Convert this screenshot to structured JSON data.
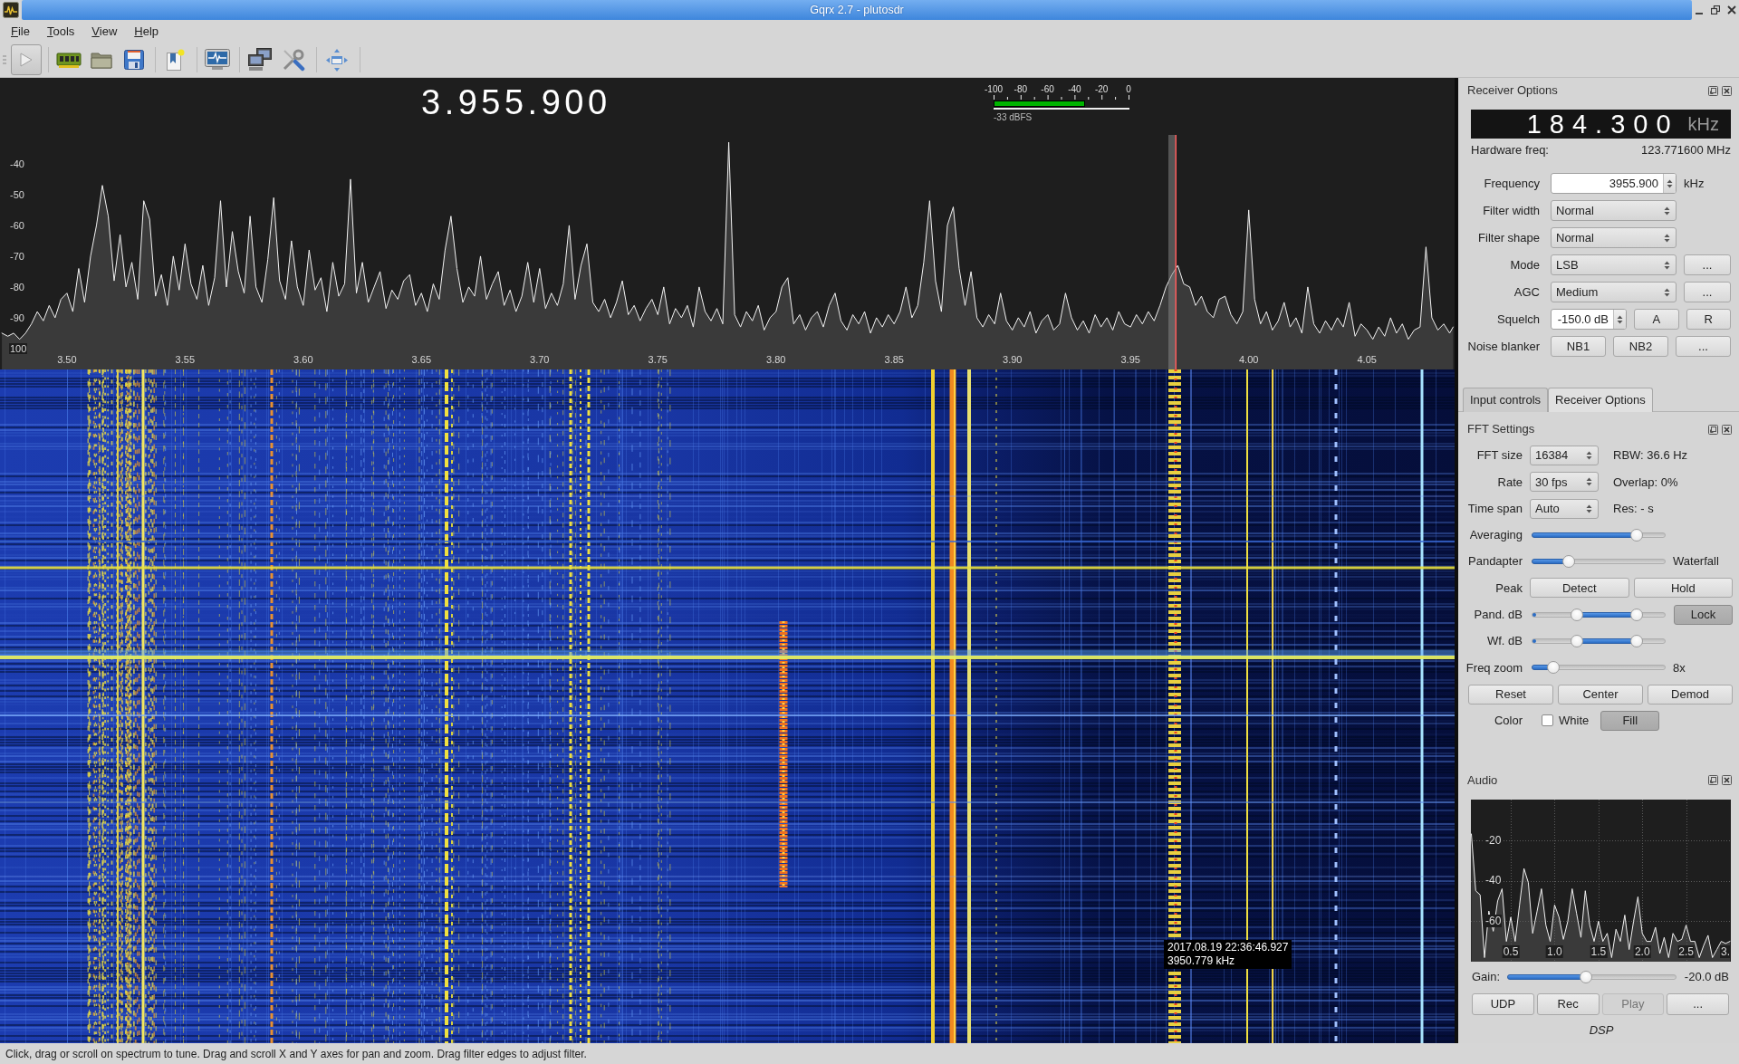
{
  "window": {
    "title": "Gqrx 2.7 - plutosdr"
  },
  "menu": [
    "File",
    "Tools",
    "View",
    "Help"
  ],
  "spectrum": {
    "frequency": "3.955.900",
    "meter": {
      "scale": [
        "-100",
        "-80",
        "-60",
        "-40",
        "-20",
        "0"
      ],
      "level": 0.67,
      "reading": "-33 dBFS"
    },
    "chart_data": {
      "type": "line",
      "xlim": [
        3.4717,
        4.0871
      ],
      "ylim": [
        -106.8,
        -12.1
      ],
      "xticks": [
        {
          "value": 3.5,
          "label": "3.50"
        },
        3.55,
        {
          "value": 3.6,
          "label": "3.60"
        },
        3.65,
        {
          "value": 3.7,
          "label": "3.70"
        },
        3.75,
        {
          "value": 3.8,
          "label": "3.80"
        },
        3.85,
        {
          "value": 3.9,
          "label": "3.90"
        },
        3.95,
        {
          "value": 4,
          "label": "4.00"
        },
        4.05
      ],
      "yticks": [
        -40,
        -50,
        -60,
        -70,
        -80,
        -90,
        {
          "value": -100,
          "label": "100"
        }
      ],
      "x": [
        3.4725,
        3.475,
        3.4775,
        3.48,
        3.4825,
        3.485,
        3.4875,
        3.49,
        3.4925,
        3.495,
        3.4975,
        3.5,
        3.5025,
        3.505,
        3.5075,
        3.51,
        3.5125,
        3.515,
        3.5175,
        3.52,
        3.5225,
        3.525,
        3.5275,
        3.53,
        3.5325,
        3.535,
        3.5375,
        3.54,
        3.5425,
        3.545,
        3.5475,
        3.55,
        3.5525,
        3.555,
        3.5575,
        3.56,
        3.5625,
        3.565,
        3.5675,
        3.57,
        3.5725,
        3.575,
        3.5775,
        3.58,
        3.5825,
        3.585,
        3.5875,
        3.59,
        3.5925,
        3.595,
        3.5975,
        3.6,
        3.6025,
        3.605,
        3.6075,
        3.61,
        3.6125,
        3.615,
        3.6175,
        3.62,
        3.6225,
        3.625,
        3.6275,
        3.63,
        3.6325,
        3.635,
        3.6375,
        3.64,
        3.6425,
        3.645,
        3.6475,
        3.65,
        3.6525,
        3.655,
        3.6575,
        3.66,
        3.6625,
        3.665,
        3.6675,
        3.67,
        3.6725,
        3.675,
        3.6775,
        3.68,
        3.6825,
        3.685,
        3.6875,
        3.69,
        3.6925,
        3.695,
        3.6975,
        3.7,
        3.7025,
        3.705,
        3.7075,
        3.71,
        3.7125,
        3.715,
        3.7175,
        3.72,
        3.7225,
        3.725,
        3.7275,
        3.73,
        3.7325,
        3.735,
        3.7375,
        3.74,
        3.7425,
        3.745,
        3.7475,
        3.75,
        3.7525,
        3.755,
        3.7575,
        3.76,
        3.7625,
        3.765,
        3.7675,
        3.77,
        3.7725,
        3.775,
        3.7775,
        3.78,
        3.7825,
        3.785,
        3.7875,
        3.79,
        3.7925,
        3.795,
        3.7975,
        3.8,
        3.8025,
        3.805,
        3.8075,
        3.81,
        3.8125,
        3.815,
        3.8175,
        3.82,
        3.8225,
        3.825,
        3.8275,
        3.83,
        3.8325,
        3.835,
        3.8375,
        3.84,
        3.8425,
        3.845,
        3.8475,
        3.85,
        3.8525,
        3.855,
        3.8575,
        3.86,
        3.8625,
        3.865,
        3.8675,
        3.87,
        3.8725,
        3.875,
        3.8775,
        3.88,
        3.8825,
        3.885,
        3.8875,
        3.89,
        3.8925,
        3.895,
        3.8975,
        3.9,
        3.9025,
        3.905,
        3.9075,
        3.91,
        3.9125,
        3.915,
        3.9175,
        3.92,
        3.9225,
        3.925,
        3.9275,
        3.93,
        3.9325,
        3.935,
        3.9375,
        3.94,
        3.9425,
        3.945,
        3.9475,
        3.95,
        3.9525,
        3.955,
        3.9575,
        3.96,
        3.9625,
        3.965,
        3.9675,
        3.97,
        3.9725,
        3.975,
        3.9775,
        3.98,
        3.9825,
        3.985,
        3.9875,
        3.99,
        3.9925,
        3.995,
        3.9975,
        4,
        4.0025,
        4.005,
        4.0075,
        4.01,
        4.0125,
        4.015,
        4.0175,
        4.02,
        4.0225,
        4.025,
        4.0275,
        4.03,
        4.0325,
        4.035,
        4.0375,
        4.04,
        4.0425,
        4.045,
        4.0475,
        4.05,
        4.0525,
        4.055,
        4.0575,
        4.06,
        4.0625,
        4.065,
        4.0675,
        4.07,
        4.0725,
        4.075,
        4.0775,
        4.08,
        4.0825,
        4.085,
        4.0865
      ],
      "values": [
        -95,
        -96,
        -95,
        -97,
        -95,
        -92,
        -88,
        -91,
        -86,
        -90,
        -84,
        -82,
        -88,
        -74,
        -85,
        -70,
        -60,
        -47,
        -57,
        -78,
        -63,
        -80,
        -72,
        -84,
        -52,
        -58,
        -83,
        -76,
        -86,
        -70,
        -81,
        -66,
        -79,
        -84,
        -73,
        -86,
        -77,
        -52,
        -80,
        -62,
        -75,
        -82,
        -57,
        -80,
        -85,
        -71,
        -51,
        -78,
        -84,
        -65,
        -80,
        -86,
        -68,
        -81,
        -77,
        -88,
        -72,
        -83,
        -79,
        -45,
        -82,
        -72,
        -85,
        -80,
        -75,
        -87,
        -81,
        -84,
        -78,
        -76,
        -86,
        -82,
        -88,
        -79,
        -84,
        -68,
        -57,
        -74,
        -85,
        -80,
        -83,
        -70,
        -84,
        -79,
        -75,
        -86,
        -81,
        -88,
        -83,
        -72,
        -85,
        -74,
        -87,
        -82,
        -86,
        -79,
        -60,
        -84,
        -73,
        -66,
        -85,
        -88,
        -84,
        -90,
        -85,
        -78,
        -89,
        -86,
        -91,
        -87,
        -84,
        -89,
        -80,
        -92,
        -87,
        -90,
        -86,
        -93,
        -80,
        -88,
        -91,
        -87,
        -92,
        -33,
        -89,
        -93,
        -88,
        -91,
        -86,
        -94,
        -90,
        -88,
        -80,
        -77,
        -92,
        -89,
        -94,
        -90,
        -88,
        -93,
        -86,
        -82,
        -91,
        -94,
        -89,
        -92,
        -88,
        -95,
        -90,
        -93,
        -89,
        -92,
        -88,
        -80,
        -90,
        -86,
        -72,
        -52,
        -78,
        -88,
        -60,
        -54,
        -74,
        -86,
        -75,
        -90,
        -93,
        -89,
        -92,
        -82,
        -91,
        -94,
        -90,
        -93,
        -88,
        -95,
        -91,
        -89,
        -94,
        -92,
        -82,
        -90,
        -94,
        -91,
        -95,
        -89,
        -93,
        -90,
        -94,
        -88,
        -92,
        -93,
        -89,
        -92,
        -88,
        -91,
        -86,
        -80,
        -76,
        -73,
        -79,
        -80,
        -86,
        -83,
        -88,
        -90,
        -84,
        -83,
        -89,
        -92,
        -88,
        -55,
        -84,
        -92,
        -88,
        -94,
        -91,
        -85,
        -93,
        -90,
        -95,
        -80,
        -92,
        -95,
        -91,
        -94,
        -90,
        -93,
        -85,
        -96,
        -92,
        -94,
        -97,
        -93,
        -96,
        -90,
        -95,
        -92,
        -97,
        -94,
        -93,
        -67,
        -90,
        -94,
        -92,
        -95,
        -93
      ]
    }
  },
  "waterfall": {
    "tooltip": {
      "time": "2017.08.19 22:36:46.927",
      "frequency": "3950.779 kHz"
    }
  },
  "receiver_options": {
    "title": "Receiver Options",
    "display": {
      "value": "184.300",
      "unit": "kHz"
    },
    "hardware_freq": {
      "label": "Hardware freq:",
      "value": "123.771600 MHz"
    },
    "rows": [
      {
        "label": "Frequency",
        "field": {
          "kind": "spinbox",
          "value": "3955.900"
        },
        "unit": "kHz"
      },
      {
        "label": "Filter width",
        "field": {
          "kind": "combo",
          "value": "Normal"
        }
      },
      {
        "label": "Filter shape",
        "field": {
          "kind": "combo",
          "value": "Normal"
        }
      },
      {
        "label": "Mode",
        "field": {
          "kind": "combo",
          "value": "LSB"
        },
        "buttons": [
          {
            "label": "..."
          }
        ]
      },
      {
        "label": "AGC",
        "field": {
          "kind": "combo",
          "value": "Medium"
        },
        "buttons": [
          {
            "label": "..."
          }
        ]
      },
      {
        "label": "Squelch",
        "field": {
          "kind": "spinbox",
          "value": "-150.0 dB"
        },
        "buttons": [
          {
            "label": "A"
          },
          {
            "label": "R"
          }
        ]
      },
      {
        "label": "Noise blanker",
        "buttons": [
          {
            "label": "NB1"
          },
          {
            "label": "NB2"
          },
          {
            "label": "..."
          }
        ]
      }
    ]
  },
  "dock_tabs": [
    {
      "label": "Input controls",
      "selected": false
    },
    {
      "label": "Receiver Options",
      "selected": true
    }
  ],
  "fft_settings": {
    "title": "FFT Settings",
    "rows": [
      {
        "kind": "combo",
        "label": "FFT size",
        "value": "16384",
        "info": "RBW: 36.6 Hz"
      },
      {
        "kind": "combo",
        "label": "Rate",
        "value": "30 fps",
        "info": "Overlap: 0%"
      },
      {
        "kind": "combo",
        "label": "Time span",
        "value": "Auto",
        "info": "Res: - s"
      },
      {
        "kind": "slider",
        "label": "Averaging",
        "level": 0.81
      },
      {
        "kind": "slider",
        "label": "Pandapter",
        "level": 0.25,
        "info": "Waterfall"
      },
      {
        "kind": "buttons",
        "label": "Peak",
        "buttons": [
          {
            "label": "Detect",
            "pressed": false
          },
          {
            "label": "Hold",
            "pressed": false
          }
        ]
      },
      {
        "kind": "range",
        "label": "Pand. dB",
        "handles": [
          {
            "level": 0.32
          },
          {
            "level": 0.81
          }
        ],
        "buttons": [
          {
            "label": "Lock",
            "pressed": true
          }
        ]
      },
      {
        "kind": "range",
        "label": "Wf. dB",
        "handles": [
          {
            "level": 0.32
          },
          {
            "level": 0.81
          }
        ]
      },
      {
        "kind": "slider",
        "label": "Freq zoom",
        "level": 0.13,
        "info": "8x"
      },
      {
        "kind": "buttons",
        "buttons": [
          {
            "label": "Reset",
            "pressed": false
          },
          {
            "label": "Center",
            "pressed": false
          },
          {
            "label": "Demod",
            "pressed": false
          }
        ]
      },
      {
        "kind": "checkbox",
        "label": "Color",
        "checkbox": {
          "label": "White",
          "checked": false
        },
        "buttons": [
          {
            "label": "Fill",
            "pressed": true
          }
        ]
      }
    ]
  },
  "audio": {
    "title": "Audio",
    "chart_data": {
      "type": "line",
      "grid": true,
      "xlim": [
        0.045,
        3.01
      ],
      "ylim": [
        -80,
        0
      ],
      "xticks": [
        0.5,
        {
          "value": 1,
          "label": "1.0"
        },
        1.5,
        {
          "value": 2,
          "label": "2.0"
        },
        2.5,
        {
          "value": 3,
          "label": "3."
        }
      ],
      "yticks": [
        -20,
        -40,
        -60
      ],
      "x": [
        0.05,
        0.1,
        0.15,
        0.2,
        0.25,
        0.3,
        0.35,
        0.4,
        0.45,
        0.5,
        0.55,
        0.6,
        0.65,
        0.7,
        0.75,
        0.8,
        0.85,
        0.9,
        0.95,
        1,
        1.05,
        1.1,
        1.15,
        1.2,
        1.25,
        1.3,
        1.35,
        1.4,
        1.45,
        1.5,
        1.55,
        1.6,
        1.65,
        1.7,
        1.75,
        1.8,
        1.85,
        1.9,
        1.95,
        2,
        2.05,
        2.1,
        2.15,
        2.2,
        2.25,
        2.3,
        2.35,
        2.4,
        2.45,
        2.5,
        2.55,
        2.6,
        2.65,
        2.7,
        2.75,
        2.8,
        2.85,
        2.9,
        2.95,
        3
      ],
      "values": [
        -17,
        -45,
        -47,
        -78,
        -55,
        -65,
        -50,
        -44,
        -70,
        -58,
        -70,
        -52,
        -34,
        -41,
        -66,
        -55,
        -44,
        -62,
        -70,
        -52,
        -58,
        -69,
        -60,
        -44,
        -56,
        -68,
        -45,
        -62,
        -70,
        -60,
        -70,
        -66,
        -78,
        -64,
        -70,
        -57,
        -74,
        -60,
        -48,
        -66,
        -70,
        -70,
        -63,
        -76,
        -68,
        -78,
        -66,
        -70,
        -69,
        -62,
        -70,
        -70,
        -78,
        -72,
        -67,
        -78,
        -74,
        -70,
        -71,
        -70
      ]
    },
    "gain": {
      "label": "Gain:",
      "level": 0.46,
      "reading": "-20.0 dB"
    },
    "buttons": [
      {
        "label": "UDP",
        "disabled": false
      },
      {
        "label": "Rec",
        "disabled": false
      },
      {
        "label": "Play",
        "disabled": true
      },
      {
        "label": "...",
        "disabled": false
      }
    ],
    "caption": "DSP"
  },
  "status_bar": {
    "message": "Click, drag or scroll on spectrum to tune. Drag and scroll X and Y axes for pan and zoom. Drag filter edges to adjust filter."
  }
}
